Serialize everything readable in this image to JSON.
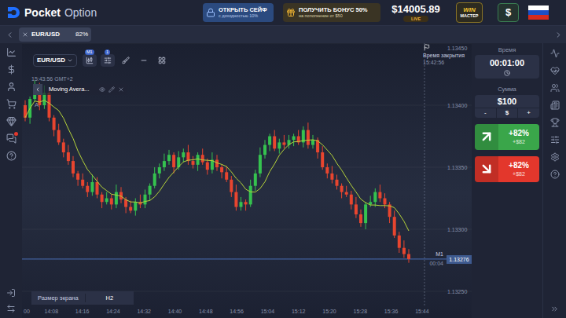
{
  "logo": {
    "name": "Pocket",
    "suffix": "Option"
  },
  "promos": [
    {
      "kind": "safe",
      "title": "ОТКРЫТЬ СЕЙФ",
      "subtitle": "с доходностью 10%"
    },
    {
      "kind": "bonus",
      "title": "ПОЛУЧИТЬ БОНУС 50%",
      "subtitle": "на пополнение от $50"
    }
  ],
  "balance": {
    "amount": "$14005.89",
    "mode": "LIVE"
  },
  "rank": {
    "top": "WIN",
    "bottom": "МАСТЕР"
  },
  "deposit_button": "$",
  "asset_tabs": [
    {
      "symbol": "EUR/USD",
      "payout": "82%",
      "selected": true
    }
  ],
  "sidebar": {
    "chat_unread": true
  },
  "chart": {
    "symbol": "EUR/USD",
    "timeframe": "M1",
    "indicator_count": "1",
    "clock": "15:43:56 GMT+2",
    "indicator": {
      "name": "Moving Avera...",
      "visible": true
    },
    "marker": "A",
    "close_time": {
      "label": "Время закрытия",
      "value": "15:42:56"
    },
    "price_axis": [
      "1.13450",
      "1.13400",
      "1.13350",
      "1.13300",
      "1.13250"
    ],
    "time_axis": [
      "00",
      "14:08",
      "14:16",
      "14:24",
      "14:32",
      "14:40",
      "14:48",
      "14:56",
      "15:04",
      "15:12",
      "15:20",
      "15:28",
      "15:36",
      "15:44"
    ],
    "current": {
      "price": "1.13276",
      "timeframe": "M1",
      "countdown": "00:04"
    },
    "screen_size": {
      "label": "Размер экрана",
      "value": "H2"
    },
    "candles": [
      [
        1.134,
        1.13404,
        1.13387,
        1.1339
      ],
      [
        1.1339,
        1.13407,
        1.13385,
        1.13405
      ],
      [
        1.13405,
        1.1342,
        1.13403,
        1.13415
      ],
      [
        1.13415,
        1.13418,
        1.13396,
        1.134
      ],
      [
        1.134,
        1.13416,
        1.13397,
        1.1341
      ],
      [
        1.1341,
        1.13414,
        1.13387,
        1.1339
      ],
      [
        1.1339,
        1.13392,
        1.13375,
        1.1338
      ],
      [
        1.1338,
        1.13385,
        1.13368,
        1.1337
      ],
      [
        1.1337,
        1.13373,
        1.13358,
        1.13362
      ],
      [
        1.13362,
        1.13368,
        1.13352,
        1.13355
      ],
      [
        1.13355,
        1.13359,
        1.13342,
        1.13345
      ],
      [
        1.13345,
        1.13347,
        1.13335,
        1.1334
      ],
      [
        1.1334,
        1.13345,
        1.13333,
        1.13335
      ],
      [
        1.13335,
        1.13338,
        1.13326,
        1.1333
      ],
      [
        1.1333,
        1.13344,
        1.13327,
        1.13338
      ],
      [
        1.13338,
        1.13342,
        1.13325,
        1.13328
      ],
      [
        1.13328,
        1.1333,
        1.13317,
        1.13322
      ],
      [
        1.13322,
        1.1333,
        1.1332,
        1.13325
      ],
      [
        1.13325,
        1.13328,
        1.13316,
        1.1332
      ],
      [
        1.1332,
        1.13336,
        1.13317,
        1.1333
      ],
      [
        1.1333,
        1.13334,
        1.13321,
        1.13324
      ],
      [
        1.13324,
        1.13326,
        1.13313,
        1.13318
      ],
      [
        1.13318,
        1.13323,
        1.13313,
        1.13315
      ],
      [
        1.13315,
        1.13325,
        1.13311,
        1.13322
      ],
      [
        1.13322,
        1.13328,
        1.13317,
        1.1332
      ],
      [
        1.1332,
        1.13332,
        1.13317,
        1.13328
      ],
      [
        1.13328,
        1.13337,
        1.13323,
        1.13335
      ],
      [
        1.13335,
        1.1335,
        1.13333,
        1.13345
      ],
      [
        1.13345,
        1.13353,
        1.13341,
        1.1335
      ],
      [
        1.1335,
        1.13361,
        1.13347,
        1.13355
      ],
      [
        1.13355,
        1.13364,
        1.13352,
        1.1336
      ],
      [
        1.1336,
        1.13362,
        1.13345,
        1.1335
      ],
      [
        1.1335,
        1.13363,
        1.13348,
        1.13358
      ],
      [
        1.13358,
        1.13365,
        1.13354,
        1.13362
      ],
      [
        1.13362,
        1.13368,
        1.13352,
        1.13355
      ],
      [
        1.13355,
        1.13359,
        1.13349,
        1.13352
      ],
      [
        1.13352,
        1.13362,
        1.13347,
        1.1336
      ],
      [
        1.1336,
        1.13365,
        1.13352,
        1.13354
      ],
      [
        1.13354,
        1.13357,
        1.13344,
        1.13348
      ],
      [
        1.13348,
        1.13362,
        1.13345,
        1.13356
      ],
      [
        1.13356,
        1.1336,
        1.13347,
        1.1335
      ],
      [
        1.1335,
        1.13352,
        1.13341,
        1.13346
      ],
      [
        1.13346,
        1.13351,
        1.13338,
        1.1334
      ],
      [
        1.1334,
        1.13343,
        1.13326,
        1.1333
      ],
      [
        1.1333,
        1.13336,
        1.13315,
        1.13318
      ],
      [
        1.13318,
        1.13326,
        1.13315,
        1.13322
      ],
      [
        1.13322,
        1.13324,
        1.13315,
        1.1332
      ],
      [
        1.1332,
        1.1334,
        1.13318,
        1.13335
      ],
      [
        1.13335,
        1.13348,
        1.13331,
        1.13345
      ],
      [
        1.13345,
        1.13366,
        1.13342,
        1.1336
      ],
      [
        1.1336,
        1.13372,
        1.13357,
        1.13368
      ],
      [
        1.13368,
        1.13377,
        1.13363,
        1.13375
      ],
      [
        1.13375,
        1.1338,
        1.13363,
        1.13365
      ],
      [
        1.13365,
        1.13373,
        1.13361,
        1.1337
      ],
      [
        1.1337,
        1.13376,
        1.13365,
        1.13368
      ],
      [
        1.13368,
        1.13376,
        1.13365,
        1.13372
      ],
      [
        1.13372,
        1.13377,
        1.13367,
        1.13375
      ],
      [
        1.13375,
        1.1338,
        1.13368,
        1.1337
      ],
      [
        1.1337,
        1.13383,
        1.13366,
        1.1338
      ],
      [
        1.1338,
        1.13386,
        1.13365,
        1.13368
      ],
      [
        1.13368,
        1.13376,
        1.13365,
        1.13372
      ],
      [
        1.13372,
        1.13374,
        1.13357,
        1.13362
      ],
      [
        1.13362,
        1.13367,
        1.13348,
        1.1335
      ],
      [
        1.1335,
        1.13353,
        1.13341,
        1.13345
      ],
      [
        1.13345,
        1.13351,
        1.13337,
        1.1334
      ],
      [
        1.1334,
        1.13344,
        1.13332,
        1.13335
      ],
      [
        1.13335,
        1.13337,
        1.13325,
        1.1333
      ],
      [
        1.1333,
        1.13335,
        1.13326,
        1.13328
      ],
      [
        1.13328,
        1.13331,
        1.13316,
        1.1332
      ],
      [
        1.1332,
        1.13326,
        1.13309,
        1.13312
      ],
      [
        1.13312,
        1.13316,
        1.13302,
        1.13305
      ],
      [
        1.13305,
        1.13322,
        1.133,
        1.1332
      ],
      [
        1.1332,
        1.13327,
        1.13318,
        1.13322
      ],
      [
        1.13322,
        1.13333,
        1.13318,
        1.1333
      ],
      [
        1.1333,
        1.13336,
        1.13322,
        1.13325
      ],
      [
        1.13325,
        1.13329,
        1.13317,
        1.1332
      ],
      [
        1.1332,
        1.13322,
        1.13305,
        1.1331
      ],
      [
        1.1331,
        1.13315,
        1.13293,
        1.13295
      ],
      [
        1.13295,
        1.13298,
        1.13281,
        1.13285
      ],
      [
        1.13285,
        1.13291,
        1.13277,
        1.1328
      ],
      [
        1.1328,
        1.13284,
        1.13273,
        1.13276
      ]
    ]
  },
  "trade": {
    "time": {
      "label": "Время",
      "value": "00:01:00"
    },
    "amount": {
      "label": "Сумма",
      "value": "$100",
      "minus": "-",
      "currency": "$",
      "plus": "+"
    },
    "buttons": [
      {
        "kind": "up",
        "payout": "+82%",
        "profit": "+$82",
        "color": "#3aa64a"
      },
      {
        "kind": "down",
        "payout": "+82%",
        "profit": "+$82",
        "color": "#e3372c"
      }
    ]
  }
}
